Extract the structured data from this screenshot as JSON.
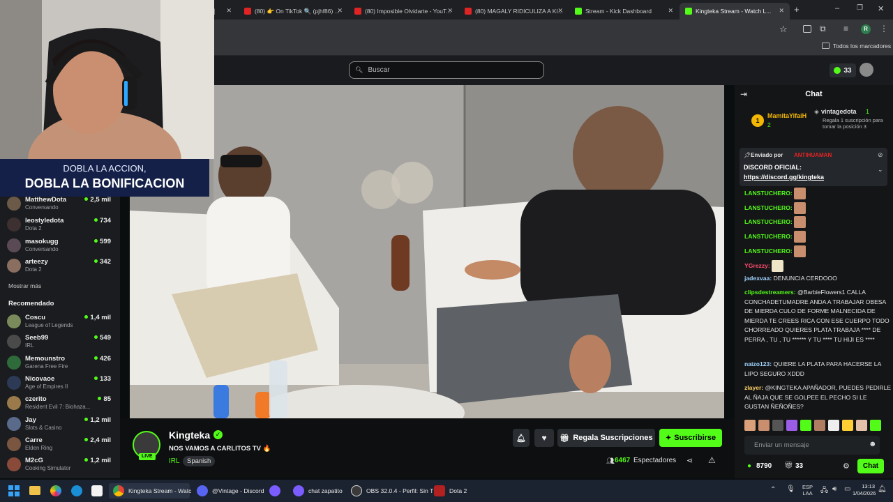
{
  "browser": {
    "tabs": [
      {
        "label": "(80) 👉 On TikTok 🔍 (pjhf86) ...",
        "favicon_color": "#e02424"
      },
      {
        "label": "(80) Imposible Olvidarte - YouT...",
        "favicon_color": "#e02424"
      },
      {
        "label": "(80) MAGALY RIDICULIZA A KI...",
        "favicon_color": "#e02424"
      },
      {
        "label": "Stream - Kick Dashboard",
        "favicon_color": "#53fc18"
      },
      {
        "label": "Kingteka Stream - Watch L...",
        "favicon_color": "#53fc18"
      }
    ],
    "new_tab_symbol": "+",
    "bookmarks_label": "Todos los marcadores",
    "profile_initial": "R"
  },
  "kick": {
    "search_placeholder": "Buscar",
    "kicks_count": "33",
    "brand_color": "#53fc18"
  },
  "sidebar": {
    "following": [
      {
        "name": "MatthewDota",
        "sub": "Conversando",
        "viewers": "2,5 mil",
        "avatar_color": "#6b5a48"
      },
      {
        "name": "leostyledota",
        "sub": "Dota 2",
        "viewers": "734",
        "avatar_color": "#3d3030"
      },
      {
        "name": "masokugg",
        "sub": "Conversando",
        "viewers": "599",
        "avatar_color": "#5a4a55"
      },
      {
        "name": "arteezy",
        "sub": "Dota 2",
        "viewers": "342",
        "avatar_color": "#8a6e60"
      }
    ],
    "show_more": "Mostrar más",
    "recommended_title": "Recomendado",
    "recommended": [
      {
        "name": "Coscu",
        "sub": "League of Legends",
        "viewers": "1,4 mil",
        "avatar_color": "#7a8a5a"
      },
      {
        "name": "Seeb99",
        "sub": "IRL",
        "viewers": "549",
        "avatar_color": "#4a4a4a"
      },
      {
        "name": "Memounstro",
        "sub": "Garena Free Fire",
        "viewers": "426",
        "avatar_color": "#2f6b3a"
      },
      {
        "name": "Nicovaoe",
        "sub": "Age of Empires II",
        "viewers": "133",
        "avatar_color": "#2c3a55"
      },
      {
        "name": "czerito",
        "sub": "Resident Evil 7: Biohaza...",
        "viewers": "85",
        "avatar_color": "#9a7a4a"
      },
      {
        "name": "Jay",
        "sub": "Slots & Casino",
        "viewers": "1,2 mil",
        "avatar_color": "#5a6a8a"
      },
      {
        "name": "Carre",
        "sub": "Elden Ring",
        "viewers": "2,4 mil",
        "avatar_color": "#7a5540"
      },
      {
        "name": "M2cG",
        "sub": "Cooking Simulator",
        "viewers": "1,2 mil",
        "avatar_color": "#8a4a3a"
      }
    ]
  },
  "promo": {
    "line1": "DOBLA LA ACCION,",
    "line2": "DOBLA LA BONIFICACION"
  },
  "stream": {
    "channel": "Kingteka",
    "title": "NOS VAMOS A CARLITOS TV 🔥",
    "category": "IRL",
    "language_tag": "Spanish",
    "live_badge": "LIVE",
    "gift_label": "Regala Suscripciones",
    "subscribe_label": "Suscribirse",
    "viewers": "6467",
    "viewers_label": "Espectadores"
  },
  "chat": {
    "title": "Chat",
    "leader1_rank": "1",
    "leader1_name": "MamitaYifaiH",
    "leader1_count": "2",
    "leader2_name": "vintagedota",
    "leader2_count": "1",
    "leader2_note": "Regala 1 suscripción para tomar la posición 3",
    "pinned_prefix": "Enviado por",
    "pinned_by": "ANTIHUAMAN",
    "pinned_title": "DISCORD OFICIAL:",
    "pinned_link": "https://discord.gg/kingteka",
    "messages": [
      {
        "user": "LANSTUCHERO:",
        "text": "",
        "emote": true,
        "user_color": "#53fc18"
      },
      {
        "user": "LANSTUCHERO:",
        "text": "",
        "emote": true,
        "user_color": "#53fc18"
      },
      {
        "user": "LANSTUCHERO:",
        "text": "",
        "emote": true,
        "user_color": "#53fc18"
      },
      {
        "user": "LANSTUCHERO:",
        "text": "",
        "emote": true,
        "user_color": "#53fc18"
      },
      {
        "user": "LANSTUCHERO:",
        "text": "",
        "emote": true,
        "user_color": "#53fc18"
      },
      {
        "user": "YGrezzy:",
        "text": "",
        "emote": true,
        "user_color": "#ff4f6e"
      },
      {
        "user": "jadexvaa:",
        "text": "DENUNCIA CERDOOO",
        "emote": false,
        "user_color": "#9fd4ff"
      },
      {
        "user": "clipsdestreamers:",
        "text": "@BarbieFlowers1 CALLA CONCHADETUMADRE ANDA A TRABAJAR OBESA DE MIERDA CULO DE FORME MALNECIDA DE MIERDA TE CREES RICA CON ESE CUERPO TODO CHORREADO QUIERES PLATA TRABAJA **** DE PERRA , TU , TU ****** Y TU **** TU HIJI ES ****",
        "emote": false,
        "user_color": "#53fc18"
      },
      {
        "user": "naizo123:",
        "text": "QUIERE LA PLATA PARA HACERSE LA LIPO SEGURO XDDD",
        "emote": false,
        "user_color": "#9fd4ff"
      },
      {
        "user": "zlayer:",
        "text": "@KINGTEKA APAÑADOR, PUEDES PEDIRLE AL ÑAJA QUE SE GOLPEE EL PECHO SI LE GUSTAN ÑEÑOÑES?",
        "emote": false,
        "user_color": "#ffd166"
      }
    ],
    "input_placeholder": "Enviar un mensaje",
    "points": "8790",
    "gifts_count": "33",
    "send_label": "Chat"
  },
  "taskbar": {
    "items": [
      {
        "label": "Kingteka Stream - Watc",
        "icon_color": "#e8b83a"
      },
      {
        "label": "@Vintage - Discord",
        "icon_color": "#5865f2"
      },
      {
        "label": "",
        "icon_color": "#7a5cff"
      },
      {
        "label": "chat zapatito",
        "icon_color": "#7a5cff"
      },
      {
        "label": "OBS 32.0.4 - Perfil: Sin T",
        "icon_color": "#3a3a3a"
      },
      {
        "label": "Dota 2",
        "icon_color": "#b32020"
      }
    ],
    "lang": "ESP",
    "lang2": "LAA",
    "time": "13:13",
    "date": "1/04/2026"
  }
}
